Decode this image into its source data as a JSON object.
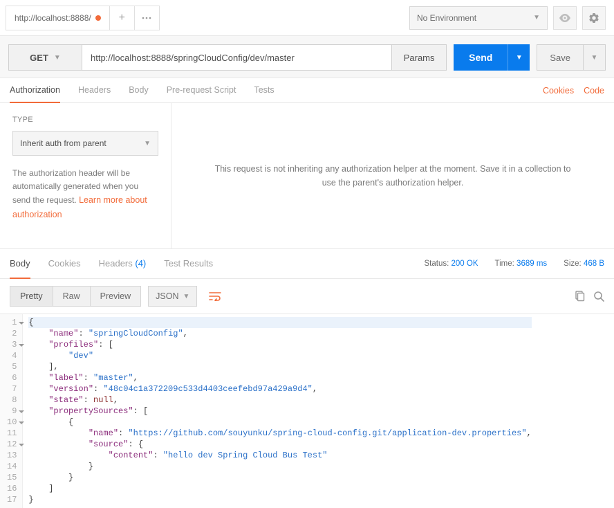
{
  "topbar": {
    "tab_title": "http://localhost:8888/",
    "env_label": "No Environment"
  },
  "request": {
    "method": "GET",
    "url": "http://localhost:8888/springCloudConfig/dev/master",
    "params_label": "Params",
    "send_label": "Send",
    "save_label": "Save"
  },
  "req_tabs": {
    "authorization": "Authorization",
    "headers": "Headers",
    "body": "Body",
    "prerequest": "Pre-request Script",
    "tests": "Tests",
    "cookies_link": "Cookies",
    "code_link": "Code"
  },
  "auth": {
    "type_label": "TYPE",
    "type_value": "Inherit auth from parent",
    "desc_prefix": "The authorization header will be automatically generated when you send the request. ",
    "learn_more": "Learn more about authorization",
    "right_msg": "This request is not inheriting any authorization helper at the moment. Save it in a collection to use the parent's authorization helper."
  },
  "resp_tabs": {
    "body": "Body",
    "cookies": "Cookies",
    "headers_label": "Headers",
    "headers_count": "(4)",
    "test_results": "Test Results"
  },
  "resp_meta": {
    "status_label": "Status:",
    "status_value": "200 OK",
    "time_label": "Time:",
    "time_value": "3689 ms",
    "size_label": "Size:",
    "size_value": "468 B"
  },
  "resp_toolbar": {
    "pretty": "Pretty",
    "raw": "Raw",
    "preview": "Preview",
    "format": "JSON"
  },
  "response_json": {
    "name": "springCloudConfig",
    "profiles": [
      "dev"
    ],
    "label": "master",
    "version": "48c04c1a372209c533d4403ceefebd97a429a9d4",
    "state": null,
    "propertySources": [
      {
        "name": "https://github.com/souyunku/spring-cloud-config.git/application-dev.properties",
        "source": {
          "content": "hello dev Spring Cloud Bus Test"
        }
      }
    ]
  },
  "code_render": {
    "lines": [
      {
        "num": 1,
        "fold": true,
        "hl": true,
        "indent": 0,
        "tokens": [
          {
            "t": "p",
            "v": "{"
          }
        ]
      },
      {
        "num": 2,
        "fold": false,
        "indent": 1,
        "tokens": [
          {
            "t": "k",
            "v": "\"name\""
          },
          {
            "t": "p",
            "v": ": "
          },
          {
            "t": "s",
            "v": "\"springCloudConfig\""
          },
          {
            "t": "p",
            "v": ","
          }
        ]
      },
      {
        "num": 3,
        "fold": true,
        "indent": 1,
        "tokens": [
          {
            "t": "k",
            "v": "\"profiles\""
          },
          {
            "t": "p",
            "v": ": ["
          }
        ]
      },
      {
        "num": 4,
        "fold": false,
        "indent": 2,
        "tokens": [
          {
            "t": "s",
            "v": "\"dev\""
          }
        ]
      },
      {
        "num": 5,
        "fold": false,
        "indent": 1,
        "tokens": [
          {
            "t": "p",
            "v": "],"
          }
        ]
      },
      {
        "num": 6,
        "fold": false,
        "indent": 1,
        "tokens": [
          {
            "t": "k",
            "v": "\"label\""
          },
          {
            "t": "p",
            "v": ": "
          },
          {
            "t": "s",
            "v": "\"master\""
          },
          {
            "t": "p",
            "v": ","
          }
        ]
      },
      {
        "num": 7,
        "fold": false,
        "indent": 1,
        "tokens": [
          {
            "t": "k",
            "v": "\"version\""
          },
          {
            "t": "p",
            "v": ": "
          },
          {
            "t": "s",
            "v": "\"48c04c1a372209c533d4403ceefebd97a429a9d4\""
          },
          {
            "t": "p",
            "v": ","
          }
        ]
      },
      {
        "num": 8,
        "fold": false,
        "indent": 1,
        "tokens": [
          {
            "t": "k",
            "v": "\"state\""
          },
          {
            "t": "p",
            "v": ": "
          },
          {
            "t": "nu",
            "v": "null"
          },
          {
            "t": "p",
            "v": ","
          }
        ]
      },
      {
        "num": 9,
        "fold": true,
        "indent": 1,
        "tokens": [
          {
            "t": "k",
            "v": "\"propertySources\""
          },
          {
            "t": "p",
            "v": ": ["
          }
        ]
      },
      {
        "num": 10,
        "fold": true,
        "indent": 2,
        "tokens": [
          {
            "t": "p",
            "v": "{"
          }
        ]
      },
      {
        "num": 11,
        "fold": false,
        "indent": 3,
        "tokens": [
          {
            "t": "k",
            "v": "\"name\""
          },
          {
            "t": "p",
            "v": ": "
          },
          {
            "t": "s",
            "v": "\"https://github.com/souyunku/spring-cloud-config.git/application-dev.properties\""
          },
          {
            "t": "p",
            "v": ","
          }
        ]
      },
      {
        "num": 12,
        "fold": true,
        "indent": 3,
        "tokens": [
          {
            "t": "k",
            "v": "\"source\""
          },
          {
            "t": "p",
            "v": ": {"
          }
        ]
      },
      {
        "num": 13,
        "fold": false,
        "indent": 4,
        "tokens": [
          {
            "t": "k",
            "v": "\"content\""
          },
          {
            "t": "p",
            "v": ": "
          },
          {
            "t": "s",
            "v": "\"hello dev Spring Cloud Bus Test\""
          }
        ]
      },
      {
        "num": 14,
        "fold": false,
        "indent": 3,
        "tokens": [
          {
            "t": "p",
            "v": "}"
          }
        ]
      },
      {
        "num": 15,
        "fold": false,
        "indent": 2,
        "tokens": [
          {
            "t": "p",
            "v": "}"
          }
        ]
      },
      {
        "num": 16,
        "fold": false,
        "indent": 1,
        "tokens": [
          {
            "t": "p",
            "v": "]"
          }
        ]
      },
      {
        "num": 17,
        "fold": false,
        "indent": 0,
        "tokens": [
          {
            "t": "p",
            "v": "}"
          }
        ]
      }
    ]
  }
}
